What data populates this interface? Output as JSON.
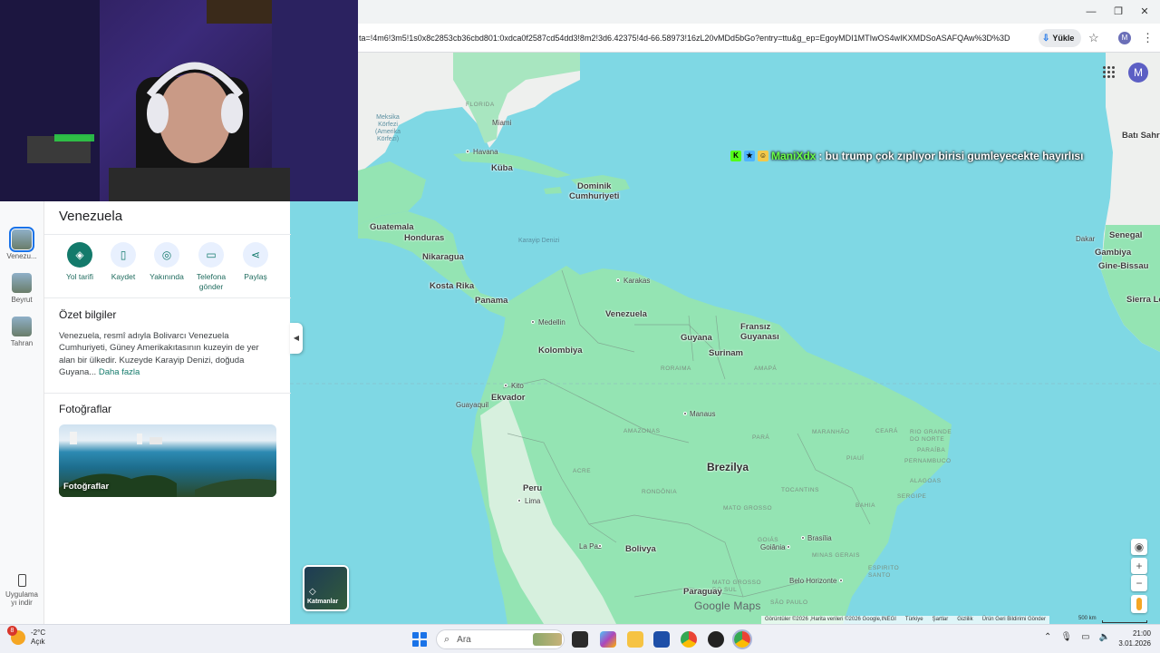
{
  "browser": {
    "url": "ta=!4m6!3m5!1s0x8c2853cb36cbd801:0xdca0f2587cd54dd3!8m2!3d6.42375!4d-66.58973!16zL20vMDd5bGo?entry=ttu&g_ep=EgoyMDI1MTIwOS4wIKXMDSoASAFQAw%3D%3D",
    "install_label": "Yükle",
    "profile_initial": "M"
  },
  "map_avatar": "M",
  "chat": {
    "user": "ManiXdx",
    "message": ": bu trump çok zıplıyor birisi gumleyecekte hayırlısı"
  },
  "rail": {
    "items": [
      {
        "label": "Venezu..."
      },
      {
        "label": "Beyrut"
      },
      {
        "label": "Tahran"
      }
    ],
    "app_label_line1": "Uygulama",
    "app_label_line2": "yı indir"
  },
  "panel": {
    "title": "Venezuela",
    "actions": [
      {
        "label": "Yol tarifi",
        "icon": "directions-icon"
      },
      {
        "label": "Kaydet",
        "icon": "bookmark-icon"
      },
      {
        "label": "Yakınında",
        "icon": "nearby-icon"
      },
      {
        "label": "Telefona\ngönder",
        "icon": "phone-icon"
      },
      {
        "label": "Paylaş",
        "icon": "share-icon"
      }
    ],
    "summary_heading": "Özet bilgiler",
    "summary_text": "Venezuela, resmî adıyla Bolivarcı Venezuela Cumhuriyeti, Güney Amerikakıtasının kuzeyin de yer alan bir ülkedir. Kuzeyde Karayip Denizi, doğuda Guyana...",
    "more_link": "Daha fazla",
    "photos_heading": "Fotoğraflar",
    "photo_label": "Fotoğraflar"
  },
  "layers_label": "Katmanlar",
  "map": {
    "countries": [
      {
        "name": "Küba"
      },
      {
        "name": "Dominik\nCumhuriyeti"
      },
      {
        "name": "Guatemala"
      },
      {
        "name": "Honduras"
      },
      {
        "name": "Nikaragua"
      },
      {
        "name": "Kosta Rika"
      },
      {
        "name": "Panama"
      },
      {
        "name": "Venezuela"
      },
      {
        "name": "Kolombiya"
      },
      {
        "name": "Guyana"
      },
      {
        "name": "Surinam"
      },
      {
        "name": "Fransız\nGuyanası"
      },
      {
        "name": "Ekvador"
      },
      {
        "name": "Peru"
      },
      {
        "name": "Brezilya"
      },
      {
        "name": "Bolivya"
      },
      {
        "name": "Paraguay"
      },
      {
        "name": "Senegal"
      },
      {
        "name": "Gambiya"
      },
      {
        "name": "Gine-Bissau"
      },
      {
        "name": "Sierra Le"
      },
      {
        "name": "Batı Sahra"
      }
    ],
    "cities": [
      {
        "name": "Miami"
      },
      {
        "name": "Havana"
      },
      {
        "name": "Karakas"
      },
      {
        "name": "Medellin"
      },
      {
        "name": "Kito"
      },
      {
        "name": "Guayaquil"
      },
      {
        "name": "Manaus"
      },
      {
        "name": "Lima"
      },
      {
        "name": "La Paz"
      },
      {
        "name": "Brasília"
      },
      {
        "name": "Goiânia"
      },
      {
        "name": "Belo Horizonte"
      },
      {
        "name": "Dakar"
      }
    ],
    "states": [
      {
        "name": "FLORIDA"
      },
      {
        "name": "RORAIMA"
      },
      {
        "name": "AMAPÁ"
      },
      {
        "name": "AMAZONAS"
      },
      {
        "name": "PARÁ"
      },
      {
        "name": "MARANHÃO"
      },
      {
        "name": "CEARÁ"
      },
      {
        "name": "RIO GRANDE\nDO NORTE"
      },
      {
        "name": "PARAÍBA"
      },
      {
        "name": "PERNAMBUCO"
      },
      {
        "name": "PIAUÍ"
      },
      {
        "name": "ALAGOAS"
      },
      {
        "name": "SERGIPE"
      },
      {
        "name": "ACRE"
      },
      {
        "name": "RONDÔNIA"
      },
      {
        "name": "TOCANTINS"
      },
      {
        "name": "BAHIA"
      },
      {
        "name": "MATO GROSSO"
      },
      {
        "name": "GOIÁS"
      },
      {
        "name": "MINAS GERAIS"
      },
      {
        "name": "MATO GROSSO\nDO SUL"
      },
      {
        "name": "ESPIRITO\nSANTO"
      },
      {
        "name": "SÃO PAULO"
      }
    ],
    "sea": "Karayip Denizi",
    "gulf": "Meksika\nKörfezi\n(Amerika\nKörfezi)"
  },
  "google_logo": "Google Maps",
  "footer": [
    "Görüntüler ©2026 ,Harita verileri ©2026 Google,INEGI",
    "Türkiye",
    "Şartlar",
    "Gizlilik",
    "Ürün Geri Bildirimi Gönder"
  ],
  "scale_label": "500 km",
  "taskbar": {
    "weather_temp": "-2°C",
    "weather_cond": "Açık",
    "weather_badge": "8",
    "search_placeholder": "Ara",
    "time": "21:00",
    "date": "3.01.2026"
  },
  "colors": {
    "ocean": "#7fd8e4",
    "land_green": "#94e4b3",
    "land_light": "#eef0ee",
    "accent": "#137a6b",
    "chat_user": "#6bff4a"
  }
}
